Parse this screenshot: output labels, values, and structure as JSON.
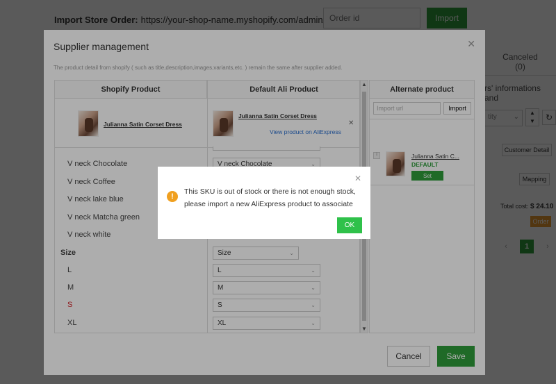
{
  "background": {
    "import_label": "Import Store Order:",
    "import_url": "https://your-shop-name.myshopify.com/admin/orders/",
    "order_id_placeholder": "Order id",
    "import_button": "Import",
    "tab_canceled": "Canceled",
    "tab_canceled_count": "(0)",
    "info_fragment": "rs' informations and",
    "select_fragment": "tity",
    "customer_detail": "Customer Detail",
    "mapping": "Mapping",
    "total_cost_label": "Total cost:",
    "total_cost_value": "$ 24.10",
    "order_button": "Order",
    "page_current": "1"
  },
  "modal": {
    "title": "Supplier management",
    "note": "The product detail from shopify ( such as title,description,images,variants,etc. ) remain the same after supplier added.",
    "col_shopify": "Shopify Product",
    "col_ali": "Default Ali Product",
    "col_alternate": "Alternate product",
    "shopify_product_name": "Julianna Satin Corset Dress",
    "ali_product_name": "Julianna Satin Corset Dress",
    "view_link": "View product on AliExpress",
    "options": [
      {
        "label": "V neck Chocolate",
        "value": "V neck Chocolate"
      },
      {
        "label": "V neck Coffee",
        "value": ""
      },
      {
        "label": "V neck lake blue",
        "value": ""
      },
      {
        "label": "V neck Matcha green",
        "value": ""
      },
      {
        "label": "V neck white",
        "value": ""
      }
    ],
    "size_label": "Size",
    "size_select": "Size",
    "sizes": [
      {
        "label": "L",
        "value": "L"
      },
      {
        "label": "M",
        "value": "M"
      },
      {
        "label": "S",
        "value": "S"
      },
      {
        "label": "XL",
        "value": "XL"
      }
    ],
    "import_url_placeholder": "Import url",
    "alt_import_button": "Import",
    "alt_product_title": "Julianna Satin C...",
    "alt_default_tag": "DEFAULT",
    "alt_set_button": "Set",
    "cancel_button": "Cancel",
    "save_button": "Save"
  },
  "alert": {
    "message_line1": "This SKU is out of stock or there is not enough stock,",
    "message_line2": "please import a new AliExpress product to associate",
    "ok_button": "OK"
  },
  "colors": {
    "primary_green": "#2e9d3a",
    "ok_green": "#2fc14a",
    "warning_orange": "#f0a020",
    "link_blue": "#2a6fcf",
    "sale_red": "#d3262c"
  }
}
